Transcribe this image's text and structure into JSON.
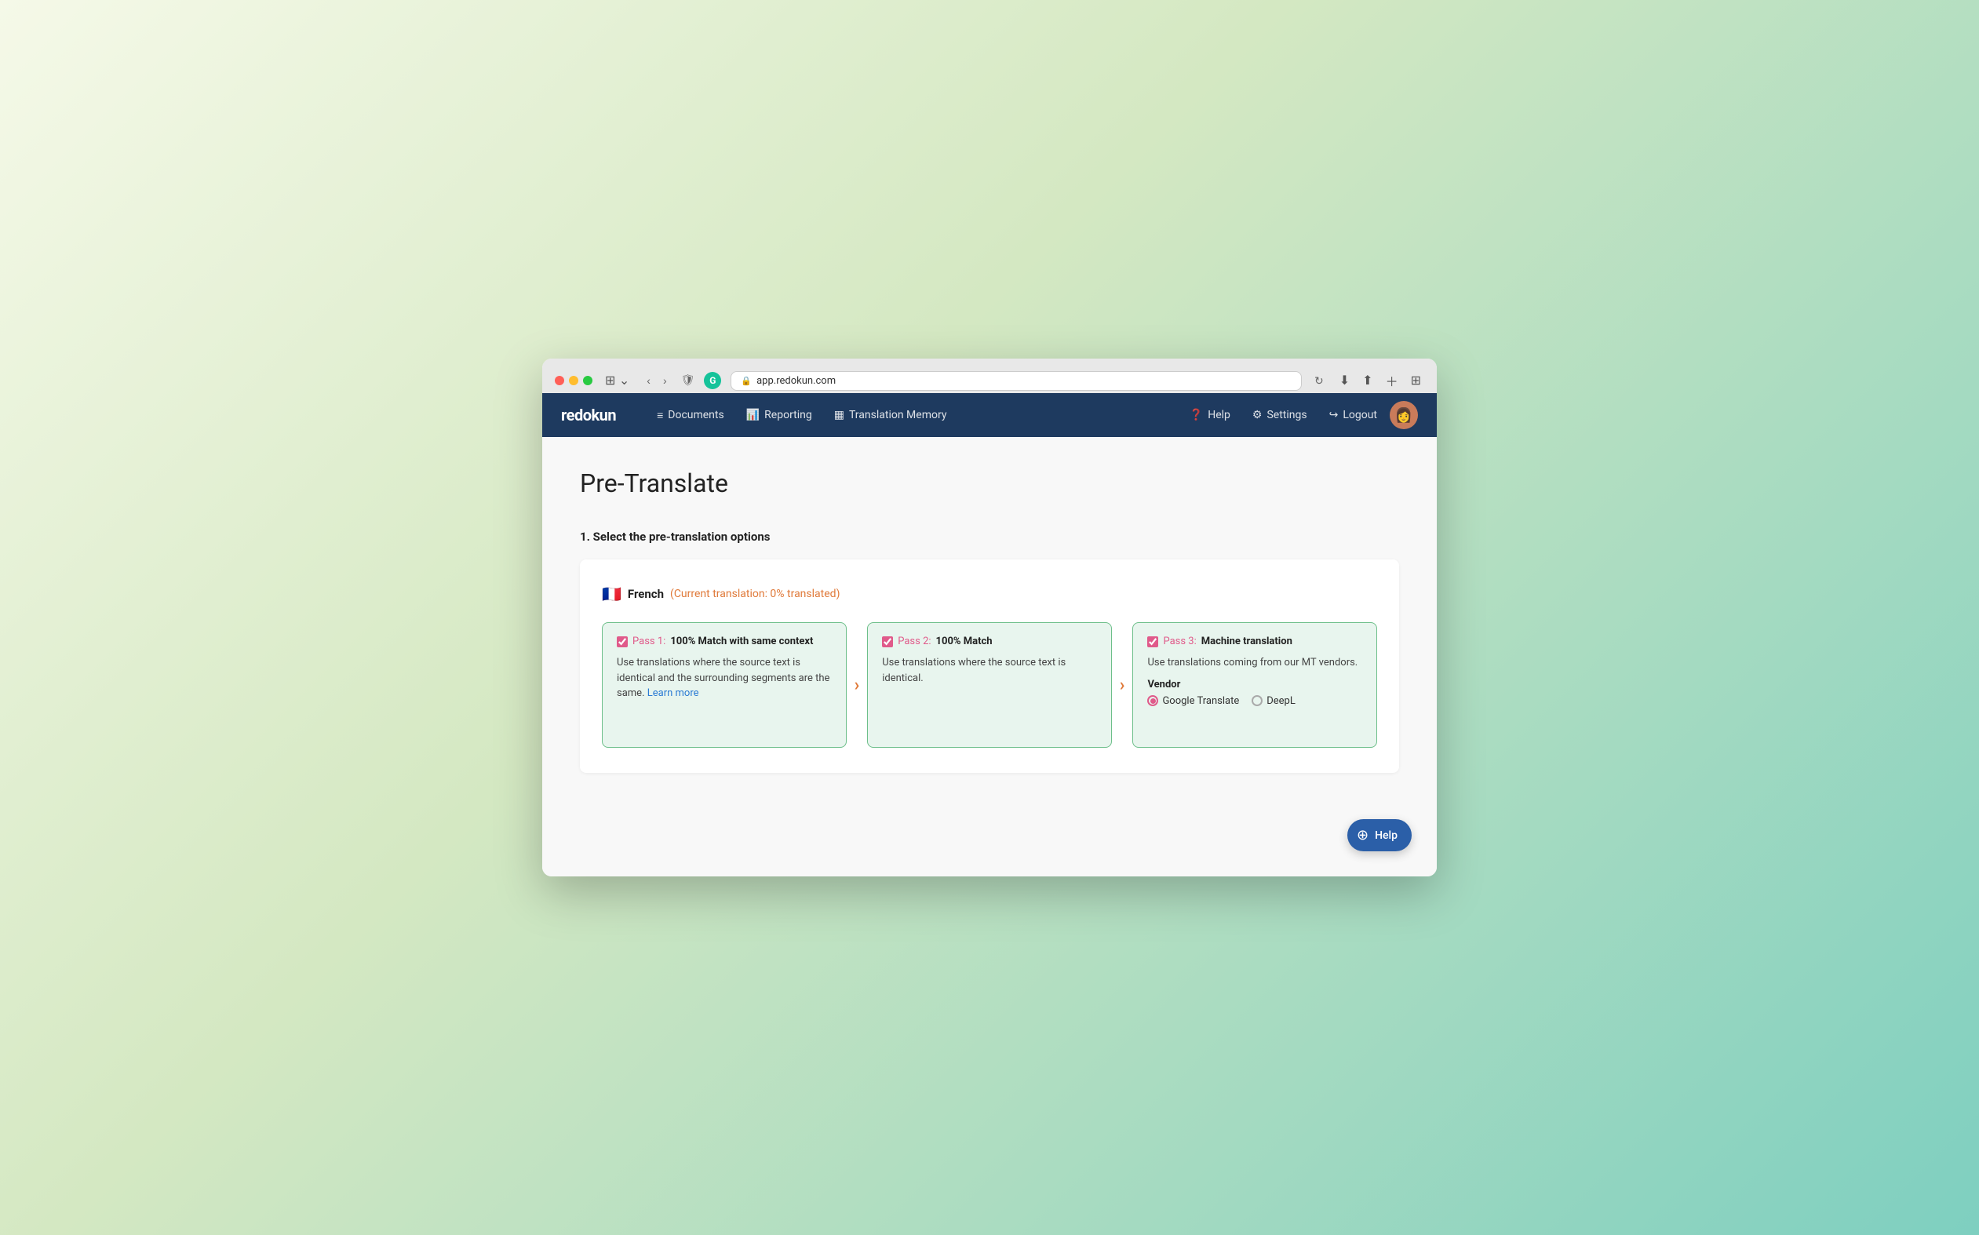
{
  "browser": {
    "address": "app.redokun.com",
    "reload_label": "↻"
  },
  "navbar": {
    "brand": "redokun",
    "documents_label": "Documents",
    "reporting_label": "Reporting",
    "translation_memory_label": "Translation Memory",
    "help_label": "Help",
    "settings_label": "Settings",
    "logout_label": "Logout"
  },
  "page": {
    "title": "Pre-Translate",
    "section_heading": "1. Select the pre-translation options",
    "language": {
      "flag": "🇫🇷",
      "name": "French",
      "status": "(Current translation: 0% translated)"
    },
    "pass1": {
      "checkbox_label": "Pass 1:",
      "title": "100% Match with same context",
      "body": "Use translations where the source text is identical and the surrounding segments are the same.",
      "learn_more": "Learn more"
    },
    "pass2": {
      "checkbox_label": "Pass 2:",
      "title": "100% Match",
      "body": "Use translations where the source text is identical."
    },
    "pass3": {
      "checkbox_label": "Pass 3:",
      "title": "Machine translation",
      "body": "Use translations coming from our MT vendors.",
      "vendor_label": "Vendor",
      "vendor1": "Google Translate",
      "vendor2": "DeepL"
    },
    "help_button": "Help"
  }
}
